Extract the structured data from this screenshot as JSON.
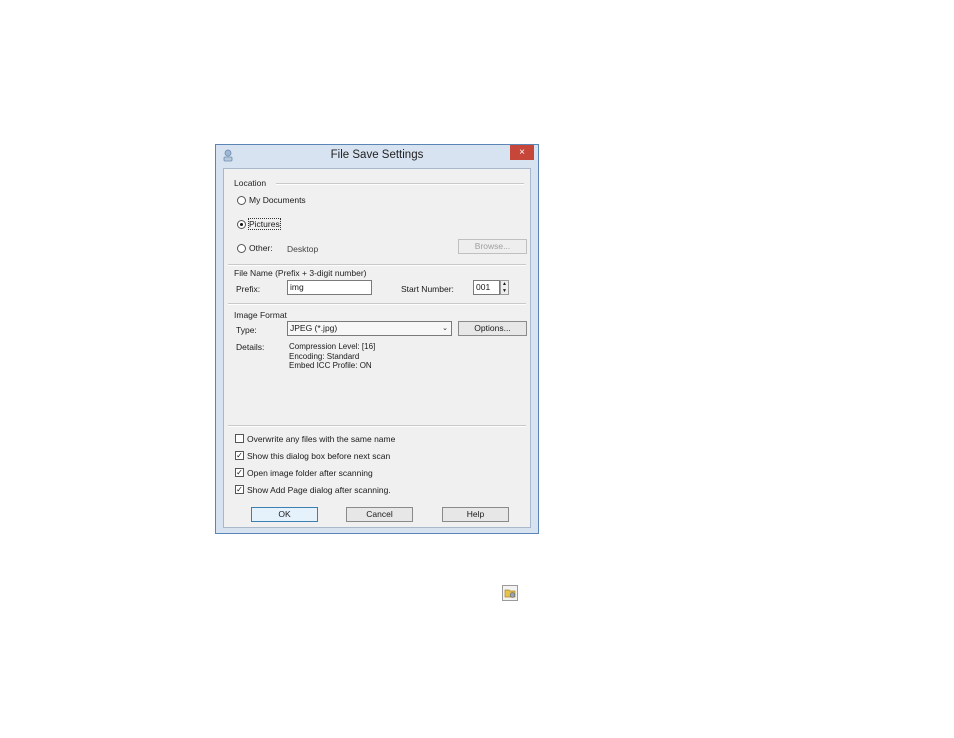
{
  "dialog": {
    "title": "File Save Settings",
    "close_glyph": "×"
  },
  "location": {
    "label": "Location",
    "my_documents": "My Documents",
    "pictures": "Pictures",
    "other": "Other:",
    "other_path": "Desktop",
    "browse": "Browse...",
    "selected": "pictures"
  },
  "file_name": {
    "label": "File Name (Prefix + 3-digit number)",
    "prefix_label": "Prefix:",
    "prefix_value": "img",
    "start_label": "Start Number:",
    "start_value": "001"
  },
  "image_format": {
    "label": "Image Format",
    "type_label": "Type:",
    "type_value": "JPEG (*.jpg)",
    "options": "Options...",
    "details_label": "Details:",
    "details": [
      "Compression Level: [16]",
      "Encoding: Standard",
      "Embed ICC Profile: ON"
    ]
  },
  "checkboxes": [
    {
      "label": "Overwrite any files with the same name",
      "checked": false
    },
    {
      "label": "Show this dialog box before next scan",
      "checked": true
    },
    {
      "label": "Open image folder after scanning",
      "checked": true
    },
    {
      "label": "Show Add Page dialog after scanning.",
      "checked": true
    }
  ],
  "buttons": {
    "ok": "OK",
    "cancel": "Cancel",
    "help": "Help"
  },
  "icons": {
    "app": "scanner-app-icon",
    "folder": "folder-settings-icon"
  },
  "colors": {
    "frame": "#d7e3f0",
    "close": "#c7463a",
    "default_button": "#3c7fb1"
  }
}
